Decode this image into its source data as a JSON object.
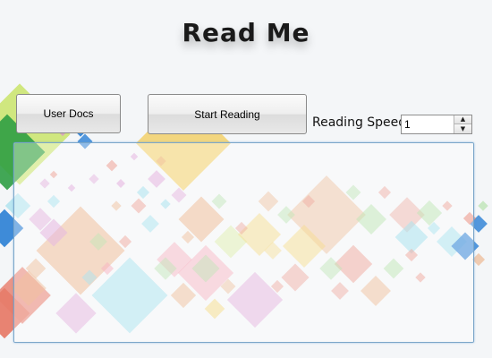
{
  "window": {
    "title": "Read Me"
  },
  "toolbar": {
    "user_docs_label": "User Docs",
    "start_reading_label": "Start Reading",
    "reading_speed_label": "Reading Speed",
    "reading_speed_value": "1"
  },
  "reader": {
    "text": ""
  },
  "colors": {
    "background": "#f4f6f8",
    "textarea_border": "#7ba6c9",
    "decor_palette": [
      "#f2c94c",
      "#e9a06a",
      "#7fd6e8",
      "#d88fd0",
      "#e77c6a",
      "#9ed98f",
      "#ffe066",
      "#f58aa0",
      "#5bb8e8",
      "#c9e46a",
      "#2f9e44",
      "#2a7fd4"
    ]
  }
}
